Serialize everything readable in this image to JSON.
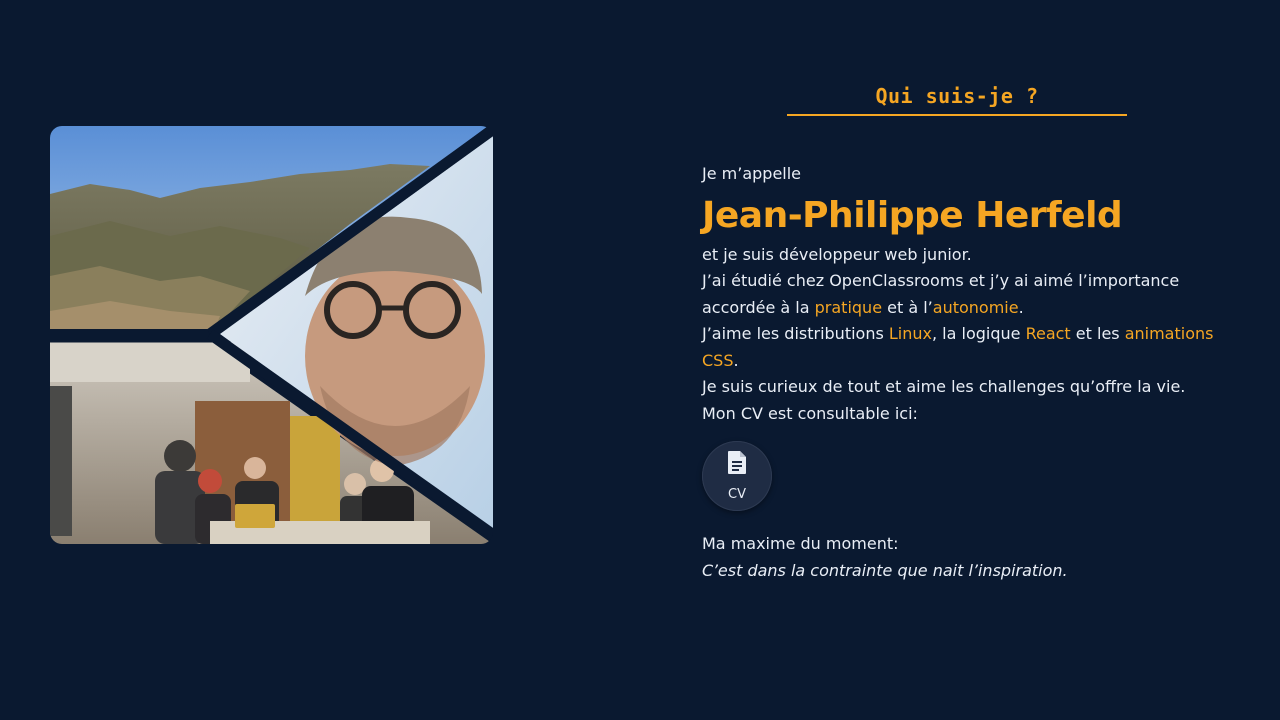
{
  "section": {
    "title": "Qui suis-je ?"
  },
  "about": {
    "intro": "Je m’appelle",
    "name": "Jean-Philippe Herfeld",
    "role_line": "et je suis développeur web junior.",
    "studied_part1": "J’ai étudié chez OpenClassrooms et j’y ai aimé l’importance accordée à la ",
    "studied_hl1": "pratique",
    "studied_part2": " et à l’",
    "studied_hl2": "autonomie",
    "studied_part3": ".",
    "likes_part1": "J’aime les distributions ",
    "likes_hl1": "Linux",
    "likes_part2": ", la logique ",
    "likes_hl2": "React",
    "likes_part3": " et les ",
    "likes_hl3": "animations CSS",
    "likes_part4": ".",
    "curious_line": "Je suis curieux de tout et aime les challenges qu’offre la vie.",
    "cv_line": "Mon CV est consultable ici:"
  },
  "cv_button": {
    "label": "CV",
    "icon": "document-icon"
  },
  "maxim": {
    "label": "Ma maxime du moment:",
    "quote": "C’est dans la contrainte que nait l’inspiration."
  },
  "colors": {
    "background": "#0a1930",
    "accent": "#f5a623",
    "text": "#e9eef6"
  }
}
